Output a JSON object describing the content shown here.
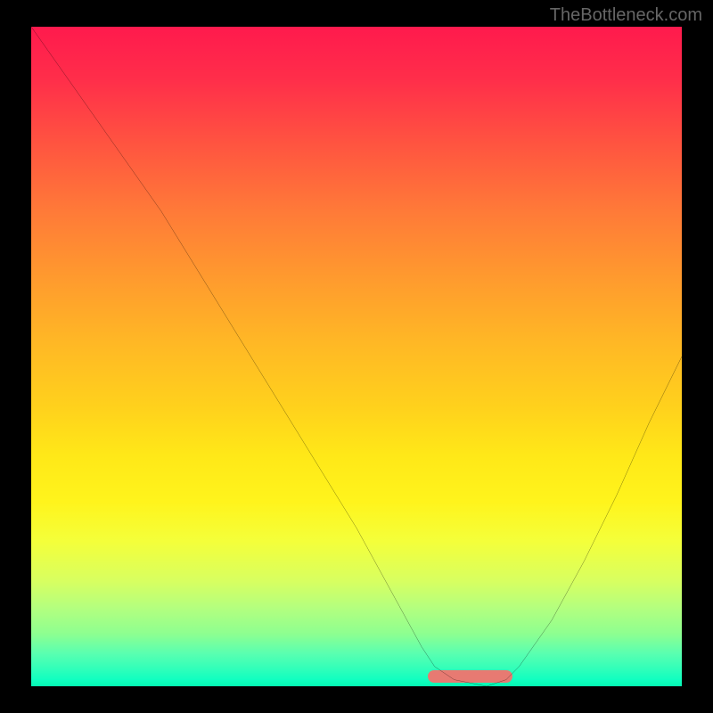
{
  "watermark": "TheBottleneck.com",
  "chart_data": {
    "type": "line",
    "title": "",
    "xlabel": "",
    "ylabel": "",
    "xlim": [
      0,
      100
    ],
    "ylim": [
      0,
      100
    ],
    "x": [
      0,
      5,
      10,
      15,
      20,
      25,
      30,
      35,
      40,
      45,
      50,
      55,
      60,
      62,
      65,
      70,
      73,
      75,
      80,
      85,
      90,
      95,
      100
    ],
    "values": [
      100,
      93,
      86,
      79,
      72,
      64,
      56,
      48,
      40,
      32,
      24,
      15,
      6,
      3,
      1,
      0,
      1,
      3,
      10,
      19,
      29,
      40,
      50
    ],
    "highlight_range_x": [
      61,
      74
    ],
    "gradient_colors": {
      "top": "#ff1a4d",
      "mid": "#ffd21c",
      "bottom": "#10ffc0"
    }
  }
}
